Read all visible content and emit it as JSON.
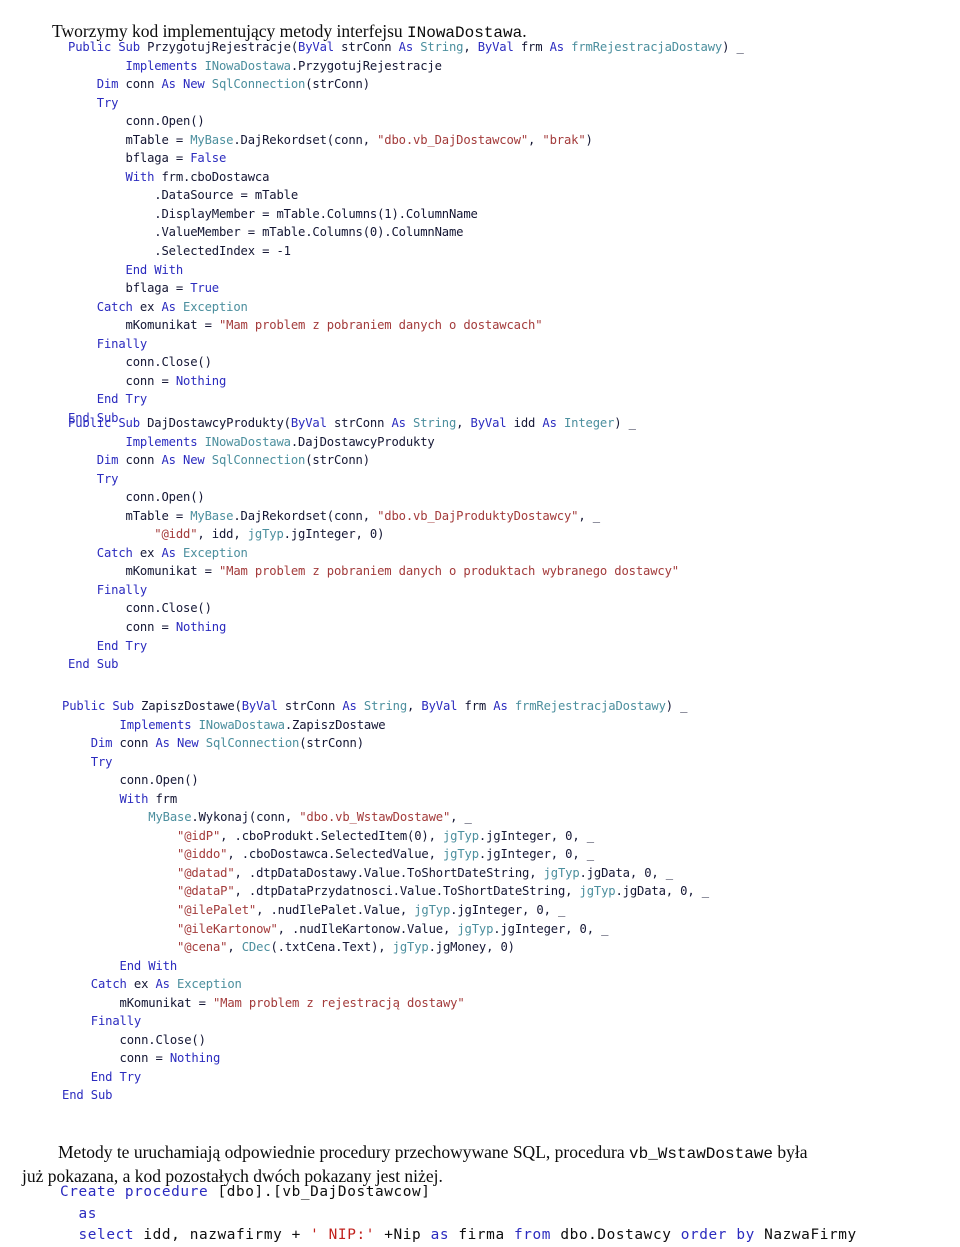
{
  "document": {
    "language": "pl",
    "intro_paragraph": {
      "text_before_mono": "Tworzymy kod implementujący metody interfejsu ",
      "mono_term": "INowaDostawa",
      "text_after_mono": "."
    },
    "closing_paragraph": {
      "line1_before_mono": "Metody te uruchamiają odpowiednie procedury przechowywane SQL, procedura ",
      "line1_mono_term": "vb_WstawDostawe",
      "line1_after_mono": " była",
      "line2": "już pokazana, a kod pozostałych dwóch pokazany jest niżej."
    }
  },
  "colors": {
    "keyword": "#2b2bbf",
    "type": "#4c8f9e",
    "string": "#a33b3b",
    "identifier": "#141634",
    "sql_keyword": "#2b2bbf",
    "sql_string": "#c0201c",
    "background": "#ffffff",
    "body_text": "#0b0b0b"
  },
  "code_blocks": [
    {
      "id": "przygotuj-rejestracje",
      "language": "vb",
      "lines": [
        [
          {
            "t": "Public Sub ",
            "c": "kw"
          },
          {
            "t": "PrzygotujRejestracje(",
            "c": "id"
          },
          {
            "t": "ByVal ",
            "c": "kw"
          },
          {
            "t": "strConn ",
            "c": "id"
          },
          {
            "t": "As ",
            "c": "kw"
          },
          {
            "t": "String",
            "c": "typ"
          },
          {
            "t": ", ",
            "c": "id"
          },
          {
            "t": "ByVal ",
            "c": "kw"
          },
          {
            "t": "frm ",
            "c": "id"
          },
          {
            "t": "As ",
            "c": "kw"
          },
          {
            "t": "frmRejestracjaDostawy",
            "c": "typ"
          },
          {
            "t": ") _",
            "c": "id"
          }
        ],
        [
          {
            "t": "        ",
            "c": "id"
          },
          {
            "t": "Implements ",
            "c": "kw"
          },
          {
            "t": "INowaDostawa",
            "c": "typ"
          },
          {
            "t": ".PrzygotujRejestracje",
            "c": "id"
          }
        ],
        [
          {
            "t": "    ",
            "c": "id"
          },
          {
            "t": "Dim ",
            "c": "kw"
          },
          {
            "t": "conn ",
            "c": "id"
          },
          {
            "t": "As New ",
            "c": "kw"
          },
          {
            "t": "SqlConnection",
            "c": "typ"
          },
          {
            "t": "(strConn)",
            "c": "id"
          }
        ],
        [
          {
            "t": "    ",
            "c": "id"
          },
          {
            "t": "Try",
            "c": "kw"
          }
        ],
        [
          {
            "t": "        conn.Open()",
            "c": "id"
          }
        ],
        [
          {
            "t": "        mTable = ",
            "c": "id"
          },
          {
            "t": "MyBase",
            "c": "typ"
          },
          {
            "t": ".DajRekordset(conn, ",
            "c": "id"
          },
          {
            "t": "\"dbo.vb_DajDostawcow\"",
            "c": "str"
          },
          {
            "t": ", ",
            "c": "id"
          },
          {
            "t": "\"brak\"",
            "c": "str"
          },
          {
            "t": ")",
            "c": "id"
          }
        ],
        [
          {
            "t": "        bflaga = ",
            "c": "id"
          },
          {
            "t": "False",
            "c": "kw"
          }
        ],
        [
          {
            "t": "        ",
            "c": "id"
          },
          {
            "t": "With ",
            "c": "kw"
          },
          {
            "t": "frm.cboDostawca",
            "c": "id"
          }
        ],
        [
          {
            "t": "            .DataSource = mTable",
            "c": "id"
          }
        ],
        [
          {
            "t": "            .DisplayMember = mTable.Columns(1).ColumnName",
            "c": "id"
          }
        ],
        [
          {
            "t": "            .ValueMember = mTable.Columns(0).ColumnName",
            "c": "id"
          }
        ],
        [
          {
            "t": "            .SelectedIndex = -1",
            "c": "id"
          }
        ],
        [
          {
            "t": "        ",
            "c": "id"
          },
          {
            "t": "End With",
            "c": "kw"
          }
        ],
        [
          {
            "t": "        bflaga = ",
            "c": "id"
          },
          {
            "t": "True",
            "c": "kw"
          }
        ],
        [
          {
            "t": "    ",
            "c": "id"
          },
          {
            "t": "Catch ",
            "c": "kw"
          },
          {
            "t": "ex ",
            "c": "id"
          },
          {
            "t": "As ",
            "c": "kw"
          },
          {
            "t": "Exception",
            "c": "typ"
          }
        ],
        [
          {
            "t": "        mKomunikat = ",
            "c": "id"
          },
          {
            "t": "\"Mam problem z pobraniem danych o dostawcach\"",
            "c": "str"
          }
        ],
        [
          {
            "t": "    ",
            "c": "id"
          },
          {
            "t": "Finally",
            "c": "kw"
          }
        ],
        [
          {
            "t": "        conn.Close()",
            "c": "id"
          }
        ],
        [
          {
            "t": "        conn = ",
            "c": "id"
          },
          {
            "t": "Nothing",
            "c": "kw"
          }
        ],
        [
          {
            "t": "    ",
            "c": "id"
          },
          {
            "t": "End Try",
            "c": "kw"
          }
        ],
        [
          {
            "t": "End Sub",
            "c": "kw"
          }
        ]
      ]
    },
    {
      "id": "daj-dostawcy-produkty",
      "language": "vb",
      "lines": [
        [
          {
            "t": "Public Sub ",
            "c": "kw"
          },
          {
            "t": "DajDostawcyProdukty(",
            "c": "id"
          },
          {
            "t": "ByVal ",
            "c": "kw"
          },
          {
            "t": "strConn ",
            "c": "id"
          },
          {
            "t": "As ",
            "c": "kw"
          },
          {
            "t": "String",
            "c": "typ"
          },
          {
            "t": ", ",
            "c": "id"
          },
          {
            "t": "ByVal ",
            "c": "kw"
          },
          {
            "t": "idd ",
            "c": "id"
          },
          {
            "t": "As ",
            "c": "kw"
          },
          {
            "t": "Integer",
            "c": "typ"
          },
          {
            "t": ") _",
            "c": "id"
          }
        ],
        [
          {
            "t": "        ",
            "c": "id"
          },
          {
            "t": "Implements ",
            "c": "kw"
          },
          {
            "t": "INowaDostawa",
            "c": "typ"
          },
          {
            "t": ".DajDostawcyProdukty",
            "c": "id"
          }
        ],
        [
          {
            "t": "    ",
            "c": "id"
          },
          {
            "t": "Dim ",
            "c": "kw"
          },
          {
            "t": "conn ",
            "c": "id"
          },
          {
            "t": "As New ",
            "c": "kw"
          },
          {
            "t": "SqlConnection",
            "c": "typ"
          },
          {
            "t": "(strConn)",
            "c": "id"
          }
        ],
        [
          {
            "t": "    ",
            "c": "id"
          },
          {
            "t": "Try",
            "c": "kw"
          }
        ],
        [
          {
            "t": "        conn.Open()",
            "c": "id"
          }
        ],
        [
          {
            "t": "        mTable = ",
            "c": "id"
          },
          {
            "t": "MyBase",
            "c": "typ"
          },
          {
            "t": ".DajRekordset(conn, ",
            "c": "id"
          },
          {
            "t": "\"dbo.vb_DajProduktyDostawcy\"",
            "c": "str"
          },
          {
            "t": ", _",
            "c": "id"
          }
        ],
        [
          {
            "t": "            ",
            "c": "id"
          },
          {
            "t": "\"@idd\"",
            "c": "str"
          },
          {
            "t": ", idd, ",
            "c": "id"
          },
          {
            "t": "jgTyp",
            "c": "typ"
          },
          {
            "t": ".jgInteger, 0)",
            "c": "id"
          }
        ],
        [
          {
            "t": "    ",
            "c": "id"
          },
          {
            "t": "Catch ",
            "c": "kw"
          },
          {
            "t": "ex ",
            "c": "id"
          },
          {
            "t": "As ",
            "c": "kw"
          },
          {
            "t": "Exception",
            "c": "typ"
          }
        ],
        [
          {
            "t": "        mKomunikat = ",
            "c": "id"
          },
          {
            "t": "\"Mam problem z pobraniem danych o produktach wybranego dostawcy\"",
            "c": "str"
          }
        ],
        [
          {
            "t": "    ",
            "c": "id"
          },
          {
            "t": "Finally",
            "c": "kw"
          }
        ],
        [
          {
            "t": "        conn.Close()",
            "c": "id"
          }
        ],
        [
          {
            "t": "        conn = ",
            "c": "id"
          },
          {
            "t": "Nothing",
            "c": "kw"
          }
        ],
        [
          {
            "t": "    ",
            "c": "id"
          },
          {
            "t": "End Try",
            "c": "kw"
          }
        ],
        [
          {
            "t": "End Sub",
            "c": "kw"
          }
        ]
      ]
    },
    {
      "id": "zapisz-dostawe",
      "language": "vb",
      "lines": [
        [
          {
            "t": "Public Sub ",
            "c": "kw"
          },
          {
            "t": "ZapiszDostawe(",
            "c": "id"
          },
          {
            "t": "ByVal ",
            "c": "kw"
          },
          {
            "t": "strConn ",
            "c": "id"
          },
          {
            "t": "As ",
            "c": "kw"
          },
          {
            "t": "String",
            "c": "typ"
          },
          {
            "t": ", ",
            "c": "id"
          },
          {
            "t": "ByVal ",
            "c": "kw"
          },
          {
            "t": "frm ",
            "c": "id"
          },
          {
            "t": "As ",
            "c": "kw"
          },
          {
            "t": "frmRejestracjaDostawy",
            "c": "typ"
          },
          {
            "t": ") _",
            "c": "id"
          }
        ],
        [
          {
            "t": "        ",
            "c": "id"
          },
          {
            "t": "Implements ",
            "c": "kw"
          },
          {
            "t": "INowaDostawa",
            "c": "typ"
          },
          {
            "t": ".ZapiszDostawe",
            "c": "id"
          }
        ],
        [
          {
            "t": "    ",
            "c": "id"
          },
          {
            "t": "Dim ",
            "c": "kw"
          },
          {
            "t": "conn ",
            "c": "id"
          },
          {
            "t": "As New ",
            "c": "kw"
          },
          {
            "t": "SqlConnection",
            "c": "typ"
          },
          {
            "t": "(strConn)",
            "c": "id"
          }
        ],
        [
          {
            "t": "    ",
            "c": "id"
          },
          {
            "t": "Try",
            "c": "kw"
          }
        ],
        [
          {
            "t": "        conn.Open()",
            "c": "id"
          }
        ],
        [
          {
            "t": "        ",
            "c": "id"
          },
          {
            "t": "With ",
            "c": "kw"
          },
          {
            "t": "frm",
            "c": "id"
          }
        ],
        [
          {
            "t": "            ",
            "c": "id"
          },
          {
            "t": "MyBase",
            "c": "typ"
          },
          {
            "t": ".Wykonaj(conn, ",
            "c": "id"
          },
          {
            "t": "\"dbo.vb_WstawDostawe\"",
            "c": "str"
          },
          {
            "t": ", _",
            "c": "id"
          }
        ],
        [
          {
            "t": "                ",
            "c": "id"
          },
          {
            "t": "\"@idP\"",
            "c": "str"
          },
          {
            "t": ", .cboProdukt.SelectedItem(0), ",
            "c": "id"
          },
          {
            "t": "jgTyp",
            "c": "typ"
          },
          {
            "t": ".jgInteger, 0, _",
            "c": "id"
          }
        ],
        [
          {
            "t": "                ",
            "c": "id"
          },
          {
            "t": "\"@iddo\"",
            "c": "str"
          },
          {
            "t": ", .cboDostawca.SelectedValue, ",
            "c": "id"
          },
          {
            "t": "jgTyp",
            "c": "typ"
          },
          {
            "t": ".jgInteger, 0, _",
            "c": "id"
          }
        ],
        [
          {
            "t": "                ",
            "c": "id"
          },
          {
            "t": "\"@datad\"",
            "c": "str"
          },
          {
            "t": ", .dtpDataDostawy.Value.ToShortDateString, ",
            "c": "id"
          },
          {
            "t": "jgTyp",
            "c": "typ"
          },
          {
            "t": ".jgData, 0, _",
            "c": "id"
          }
        ],
        [
          {
            "t": "                ",
            "c": "id"
          },
          {
            "t": "\"@dataP\"",
            "c": "str"
          },
          {
            "t": ", .dtpDataPrzydatnosci.Value.ToShortDateString, ",
            "c": "id"
          },
          {
            "t": "jgTyp",
            "c": "typ"
          },
          {
            "t": ".jgData, 0, _",
            "c": "id"
          }
        ],
        [
          {
            "t": "                ",
            "c": "id"
          },
          {
            "t": "\"@ilePalet\"",
            "c": "str"
          },
          {
            "t": ", .nudIlePalet.Value, ",
            "c": "id"
          },
          {
            "t": "jgTyp",
            "c": "typ"
          },
          {
            "t": ".jgInteger, 0, _",
            "c": "id"
          }
        ],
        [
          {
            "t": "                ",
            "c": "id"
          },
          {
            "t": "\"@ileKartonow\"",
            "c": "str"
          },
          {
            "t": ", .nudIleKartonow.Value, ",
            "c": "id"
          },
          {
            "t": "jgTyp",
            "c": "typ"
          },
          {
            "t": ".jgInteger, 0, _",
            "c": "id"
          }
        ],
        [
          {
            "t": "                ",
            "c": "id"
          },
          {
            "t": "\"@cena\"",
            "c": "str"
          },
          {
            "t": ", ",
            "c": "id"
          },
          {
            "t": "CDec",
            "c": "typ"
          },
          {
            "t": "(.txtCena.Text), ",
            "c": "id"
          },
          {
            "t": "jgTyp",
            "c": "typ"
          },
          {
            "t": ".jgMoney, 0)",
            "c": "id"
          }
        ],
        [
          {
            "t": "        ",
            "c": "id"
          },
          {
            "t": "End With",
            "c": "kw"
          }
        ],
        [
          {
            "t": "    ",
            "c": "id"
          },
          {
            "t": "Catch ",
            "c": "kw"
          },
          {
            "t": "ex ",
            "c": "id"
          },
          {
            "t": "As ",
            "c": "kw"
          },
          {
            "t": "Exception",
            "c": "typ"
          }
        ],
        [
          {
            "t": "        mKomunikat = ",
            "c": "id"
          },
          {
            "t": "\"Mam problem z rejestracją dostawy\"",
            "c": "str"
          }
        ],
        [
          {
            "t": "    ",
            "c": "id"
          },
          {
            "t": "Finally",
            "c": "kw"
          }
        ],
        [
          {
            "t": "        conn.Close()",
            "c": "id"
          }
        ],
        [
          {
            "t": "        conn = ",
            "c": "id"
          },
          {
            "t": "Nothing",
            "c": "kw"
          }
        ],
        [
          {
            "t": "    ",
            "c": "id"
          },
          {
            "t": "End Try",
            "c": "kw"
          }
        ],
        [
          {
            "t": "End Sub",
            "c": "kw"
          }
        ]
      ]
    }
  ],
  "sql_block": {
    "id": "vb-dajdostawcow-procedure",
    "language": "sql",
    "lines": [
      [
        {
          "t": "Create procedure ",
          "c": "sqlkw"
        },
        {
          "t": "[dbo].[vb_DajDostawcow]",
          "c": "sqlid"
        }
      ],
      [
        {
          "t": "  ",
          "c": "sqlid"
        },
        {
          "t": "as",
          "c": "sqlkw"
        }
      ],
      [
        {
          "t": "  ",
          "c": "sqlid"
        },
        {
          "t": "select ",
          "c": "sqlkw"
        },
        {
          "t": "idd, nazwafirmy + ",
          "c": "sqlid"
        },
        {
          "t": "' NIP:'",
          "c": "sqlstr"
        },
        {
          "t": " +Nip ",
          "c": "sqlid"
        },
        {
          "t": "as ",
          "c": "sqlkw"
        },
        {
          "t": "firma ",
          "c": "sqlid"
        },
        {
          "t": "from ",
          "c": "sqlkw"
        },
        {
          "t": "dbo.Dostawcy ",
          "c": "sqlid"
        },
        {
          "t": "order by ",
          "c": "sqlkw"
        },
        {
          "t": "NazwaFirmy",
          "c": "sqlid"
        }
      ]
    ]
  }
}
